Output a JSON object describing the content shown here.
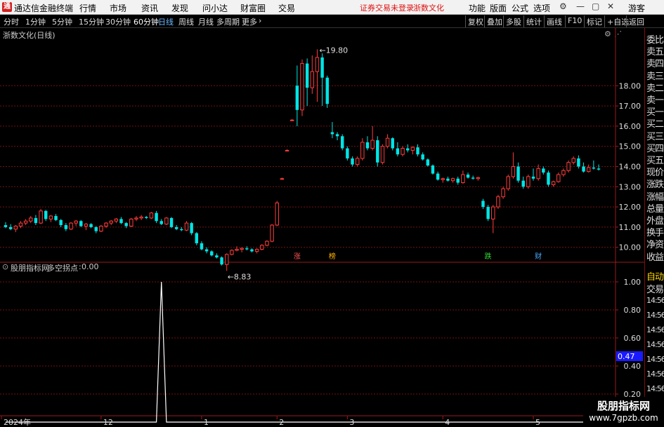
{
  "app": {
    "title": "通达信金融终端",
    "logo": "通",
    "menus": [
      "行情",
      "市场",
      "资讯",
      "发现",
      "问小达",
      "财富圈",
      "交易"
    ],
    "warning": "证券交易未登录",
    "stock_name_top": "浙数文化",
    "right_menus": [
      "功能",
      "版面",
      "公式",
      "选项"
    ],
    "user": "游客"
  },
  "period_bar": {
    "periods": [
      "分时",
      "1分钟",
      "5分钟",
      "15分钟",
      "30分钟",
      "60分钟",
      "日线",
      "周线",
      "月线",
      "多周期",
      "更多"
    ],
    "active": "日线",
    "tools": [
      "复权",
      "叠加",
      "多股",
      "统计",
      "画线",
      "F10",
      "标记",
      "+自选",
      "返回"
    ]
  },
  "main_chart": {
    "title": "浙数文化(日线)",
    "high_label": "19.80",
    "low_label": "8.83",
    "markers": [
      {
        "text": "涨",
        "color": "#ff5555"
      },
      {
        "text": "榜",
        "color": "#ffb300"
      },
      {
        "text": "跌",
        "color": "#33dd33"
      },
      {
        "text": "财",
        "color": "#4aa8ff"
      }
    ],
    "y_ticks": [
      "18.00",
      "17.00",
      "16.00",
      "15.00",
      "14.00",
      "13.00",
      "12.00",
      "11.00",
      "10.00"
    ],
    "y_range": [
      9.4,
      20.3
    ]
  },
  "indicator_chart": {
    "name": "股朋指标网",
    "line_name": "多空拐点",
    "value": "0.00",
    "y_ticks": [
      "1.00",
      "0.80",
      "0.60",
      "0.40",
      "0.20"
    ],
    "current_marker": "0.47",
    "y_range": [
      0.06,
      1.08
    ]
  },
  "x_axis": {
    "labels": [
      "2024年",
      "12",
      "1",
      "2",
      "3",
      "4",
      "5"
    ]
  },
  "side_panel": {
    "items": [
      "委比",
      "卖五",
      "卖四",
      "卖三",
      "卖二",
      "卖一",
      "买一",
      "买二",
      "买三",
      "买四",
      "买五",
      "现价",
      "涨跌",
      "涨幅",
      "总量",
      "外盘",
      "换手",
      "净资",
      "收益"
    ],
    "lower_items": [
      "自动",
      "交易"
    ],
    "times": [
      "14:56",
      "14:56",
      "14:56",
      "14:56",
      "14:56",
      "14:56",
      "14:56",
      "14:56",
      "14:56"
    ]
  },
  "watermark": {
    "line1": "股朋指标网",
    "line2": "www.7gpzb.com"
  },
  "colors": {
    "up": "#ff3c3c",
    "down": "#00e5e5",
    "grid": "#7a1010",
    "axis": "#9a1a1a",
    "indicator_line": "#ffffff",
    "marker_box": "#1a1aff"
  },
  "chart_data": {
    "type": "candlestick",
    "title": "浙数文化(日线)",
    "y_range": [
      9.4,
      20.3
    ],
    "candles": [
      {
        "o": 11.1,
        "h": 11.25,
        "l": 10.95,
        "c": 11.0
      },
      {
        "o": 11.0,
        "h": 11.15,
        "l": 10.85,
        "c": 10.9
      },
      {
        "o": 10.9,
        "h": 11.1,
        "l": 10.75,
        "c": 11.05
      },
      {
        "o": 11.05,
        "h": 11.3,
        "l": 10.95,
        "c": 11.2
      },
      {
        "o": 11.2,
        "h": 11.4,
        "l": 11.1,
        "c": 11.3
      },
      {
        "o": 11.3,
        "h": 11.55,
        "l": 11.2,
        "c": 11.45
      },
      {
        "o": 11.45,
        "h": 11.6,
        "l": 11.1,
        "c": 11.2
      },
      {
        "o": 11.2,
        "h": 11.9,
        "l": 11.15,
        "c": 11.8
      },
      {
        "o": 11.8,
        "h": 11.85,
        "l": 11.3,
        "c": 11.4
      },
      {
        "o": 11.4,
        "h": 11.6,
        "l": 11.25,
        "c": 11.55
      },
      {
        "o": 11.55,
        "h": 11.65,
        "l": 11.3,
        "c": 11.35
      },
      {
        "o": 11.35,
        "h": 11.4,
        "l": 11.0,
        "c": 11.1
      },
      {
        "o": 11.1,
        "h": 11.2,
        "l": 10.8,
        "c": 10.9
      },
      {
        "o": 10.9,
        "h": 11.25,
        "l": 10.85,
        "c": 11.2
      },
      {
        "o": 11.2,
        "h": 11.35,
        "l": 11.05,
        "c": 11.3
      },
      {
        "o": 11.3,
        "h": 11.35,
        "l": 11.0,
        "c": 11.05
      },
      {
        "o": 11.05,
        "h": 11.2,
        "l": 10.85,
        "c": 11.15
      },
      {
        "o": 11.15,
        "h": 11.2,
        "l": 10.95,
        "c": 11.0
      },
      {
        "o": 11.0,
        "h": 11.05,
        "l": 10.7,
        "c": 10.8
      },
      {
        "o": 10.8,
        "h": 11.1,
        "l": 10.75,
        "c": 11.05
      },
      {
        "o": 11.05,
        "h": 11.25,
        "l": 10.95,
        "c": 11.2
      },
      {
        "o": 11.2,
        "h": 11.35,
        "l": 11.1,
        "c": 11.3
      },
      {
        "o": 11.3,
        "h": 11.45,
        "l": 11.2,
        "c": 11.4
      },
      {
        "o": 11.4,
        "h": 11.5,
        "l": 11.15,
        "c": 11.2
      },
      {
        "o": 11.2,
        "h": 11.25,
        "l": 10.95,
        "c": 11.05
      },
      {
        "o": 11.05,
        "h": 11.45,
        "l": 11.0,
        "c": 11.4
      },
      {
        "o": 11.4,
        "h": 11.55,
        "l": 11.3,
        "c": 11.45
      },
      {
        "o": 11.45,
        "h": 11.6,
        "l": 11.35,
        "c": 11.5
      },
      {
        "o": 11.5,
        "h": 11.55,
        "l": 11.4,
        "c": 11.45
      },
      {
        "o": 11.45,
        "h": 11.75,
        "l": 11.4,
        "c": 11.7
      },
      {
        "o": 11.7,
        "h": 11.8,
        "l": 11.2,
        "c": 11.3
      },
      {
        "o": 11.3,
        "h": 11.4,
        "l": 11.1,
        "c": 11.15
      },
      {
        "o": 11.15,
        "h": 11.5,
        "l": 11.1,
        "c": 11.45
      },
      {
        "o": 11.45,
        "h": 11.5,
        "l": 10.95,
        "c": 11.0
      },
      {
        "o": 11.0,
        "h": 11.1,
        "l": 10.85,
        "c": 10.9
      },
      {
        "o": 10.9,
        "h": 11.0,
        "l": 10.8,
        "c": 10.85
      },
      {
        "o": 10.85,
        "h": 11.3,
        "l": 10.8,
        "c": 11.2
      },
      {
        "o": 11.2,
        "h": 11.25,
        "l": 10.6,
        "c": 10.7
      },
      {
        "o": 10.7,
        "h": 10.75,
        "l": 10.1,
        "c": 10.2
      },
      {
        "o": 10.2,
        "h": 10.3,
        "l": 9.85,
        "c": 9.9
      },
      {
        "o": 9.9,
        "h": 10.0,
        "l": 9.7,
        "c": 9.8
      },
      {
        "o": 9.8,
        "h": 9.85,
        "l": 9.55,
        "c": 9.6
      },
      {
        "o": 9.6,
        "h": 9.7,
        "l": 9.45,
        "c": 9.5
      },
      {
        "o": 9.5,
        "h": 9.55,
        "l": 9.1,
        "c": 9.15
      },
      {
        "o": 9.15,
        "h": 9.7,
        "l": 8.83,
        "c": 9.65
      },
      {
        "o": 9.65,
        "h": 9.9,
        "l": 9.6,
        "c": 9.85
      },
      {
        "o": 9.85,
        "h": 10.05,
        "l": 9.8,
        "c": 9.9
      },
      {
        "o": 9.9,
        "h": 10.0,
        "l": 9.75,
        "c": 9.95
      },
      {
        "o": 9.95,
        "h": 10.05,
        "l": 9.85,
        "c": 9.9
      },
      {
        "o": 9.9,
        "h": 9.95,
        "l": 9.75,
        "c": 9.8
      },
      {
        "o": 9.8,
        "h": 9.95,
        "l": 9.7,
        "c": 9.9
      },
      {
        "o": 9.9,
        "h": 10.15,
        "l": 9.85,
        "c": 10.1
      },
      {
        "o": 10.1,
        "h": 10.35,
        "l": 10.05,
        "c": 10.3
      },
      {
        "o": 10.3,
        "h": 11.15,
        "l": 10.25,
        "c": 11.1
      },
      {
        "o": 11.1,
        "h": 12.3,
        "l": 11.05,
        "c": 12.2
      },
      {
        "o": 13.4,
        "h": 13.45,
        "l": 13.4,
        "c": 13.4
      },
      {
        "o": 14.8,
        "h": 14.85,
        "l": 14.8,
        "c": 14.8
      },
      {
        "o": 16.3,
        "h": 16.35,
        "l": 16.3,
        "c": 16.3
      },
      {
        "o": 18.0,
        "h": 19.0,
        "l": 16.0,
        "c": 16.8
      },
      {
        "o": 16.8,
        "h": 19.3,
        "l": 16.5,
        "c": 19.1
      },
      {
        "o": 19.1,
        "h": 19.35,
        "l": 17.0,
        "c": 17.9
      },
      {
        "o": 17.9,
        "h": 19.5,
        "l": 17.6,
        "c": 18.7
      },
      {
        "o": 18.7,
        "h": 19.8,
        "l": 17.2,
        "c": 19.4
      },
      {
        "o": 19.4,
        "h": 19.6,
        "l": 17.0,
        "c": 18.4
      },
      {
        "o": 18.4,
        "h": 18.5,
        "l": 16.9,
        "c": 17.1
      },
      {
        "o": 15.7,
        "h": 16.2,
        "l": 15.4,
        "c": 15.6
      },
      {
        "o": 15.6,
        "h": 15.7,
        "l": 15.3,
        "c": 15.5
      },
      {
        "o": 15.5,
        "h": 15.6,
        "l": 14.8,
        "c": 14.9
      },
      {
        "o": 14.9,
        "h": 15.0,
        "l": 14.3,
        "c": 14.4
      },
      {
        "o": 14.4,
        "h": 14.5,
        "l": 14.0,
        "c": 14.1
      },
      {
        "o": 14.1,
        "h": 14.5,
        "l": 14.0,
        "c": 14.4
      },
      {
        "o": 14.4,
        "h": 15.4,
        "l": 14.3,
        "c": 15.2
      },
      {
        "o": 15.2,
        "h": 15.5,
        "l": 14.8,
        "c": 14.9
      },
      {
        "o": 14.9,
        "h": 16.0,
        "l": 14.8,
        "c": 15.3
      },
      {
        "o": 15.3,
        "h": 15.5,
        "l": 14.0,
        "c": 14.2
      },
      {
        "o": 14.2,
        "h": 15.1,
        "l": 14.1,
        "c": 15.0
      },
      {
        "o": 15.0,
        "h": 15.6,
        "l": 14.9,
        "c": 15.4
      },
      {
        "o": 15.4,
        "h": 15.45,
        "l": 14.8,
        "c": 14.9
      },
      {
        "o": 14.9,
        "h": 15.2,
        "l": 14.5,
        "c": 14.6
      },
      {
        "o": 14.6,
        "h": 15.0,
        "l": 14.5,
        "c": 14.9
      },
      {
        "o": 14.9,
        "h": 15.1,
        "l": 14.7,
        "c": 14.8
      },
      {
        "o": 14.8,
        "h": 15.0,
        "l": 14.6,
        "c": 14.95
      },
      {
        "o": 14.95,
        "h": 15.1,
        "l": 14.5,
        "c": 14.6
      },
      {
        "o": 14.6,
        "h": 14.7,
        "l": 14.3,
        "c": 14.35
      },
      {
        "o": 14.35,
        "h": 14.4,
        "l": 14.0,
        "c": 14.05
      },
      {
        "o": 14.05,
        "h": 14.1,
        "l": 13.6,
        "c": 13.65
      },
      {
        "o": 13.65,
        "h": 13.75,
        "l": 13.3,
        "c": 13.35
      },
      {
        "o": 13.35,
        "h": 13.45,
        "l": 13.2,
        "c": 13.4
      },
      {
        "o": 13.4,
        "h": 13.5,
        "l": 13.25,
        "c": 13.3
      },
      {
        "o": 13.3,
        "h": 13.45,
        "l": 13.2,
        "c": 13.4
      },
      {
        "o": 13.4,
        "h": 13.5,
        "l": 13.1,
        "c": 13.2
      },
      {
        "o": 13.2,
        "h": 13.8,
        "l": 13.15,
        "c": 13.6
      },
      {
        "o": 13.6,
        "h": 13.7,
        "l": 13.4,
        "c": 13.45
      },
      {
        "o": 13.45,
        "h": 13.55,
        "l": 13.35,
        "c": 13.4
      },
      {
        "o": 13.4,
        "h": 13.5,
        "l": 13.3,
        "c": 13.45
      },
      {
        "o": 12.3,
        "h": 12.4,
        "l": 11.9,
        "c": 12.0
      },
      {
        "o": 12.0,
        "h": 12.1,
        "l": 11.3,
        "c": 11.4
      },
      {
        "o": 11.4,
        "h": 12.1,
        "l": 10.7,
        "c": 12.0
      },
      {
        "o": 12.0,
        "h": 12.6,
        "l": 11.9,
        "c": 12.5
      },
      {
        "o": 12.5,
        "h": 13.0,
        "l": 12.4,
        "c": 12.9
      },
      {
        "o": 12.9,
        "h": 13.6,
        "l": 12.8,
        "c": 13.5
      },
      {
        "o": 13.5,
        "h": 14.7,
        "l": 13.4,
        "c": 14.0
      },
      {
        "o": 14.0,
        "h": 14.2,
        "l": 13.2,
        "c": 13.3
      },
      {
        "o": 13.3,
        "h": 13.5,
        "l": 12.9,
        "c": 13.0
      },
      {
        "o": 13.0,
        "h": 13.6,
        "l": 12.9,
        "c": 13.5
      },
      {
        "o": 13.5,
        "h": 13.9,
        "l": 13.3,
        "c": 13.4
      },
      {
        "o": 13.4,
        "h": 14.1,
        "l": 13.3,
        "c": 13.9
      },
      {
        "o": 13.9,
        "h": 14.0,
        "l": 13.6,
        "c": 13.7
      },
      {
        "o": 13.7,
        "h": 13.8,
        "l": 13.0,
        "c": 13.1
      },
      {
        "o": 13.1,
        "h": 13.3,
        "l": 13.0,
        "c": 13.25
      },
      {
        "o": 13.25,
        "h": 13.7,
        "l": 13.2,
        "c": 13.6
      },
      {
        "o": 13.6,
        "h": 13.9,
        "l": 13.5,
        "c": 13.8
      },
      {
        "o": 13.8,
        "h": 14.3,
        "l": 13.7,
        "c": 14.2
      },
      {
        "o": 14.2,
        "h": 14.5,
        "l": 14.1,
        "c": 14.4
      },
      {
        "o": 14.4,
        "h": 14.55,
        "l": 13.9,
        "c": 14.0
      },
      {
        "o": 14.0,
        "h": 14.2,
        "l": 13.7,
        "c": 13.75
      },
      {
        "o": 13.75,
        "h": 14.1,
        "l": 13.7,
        "c": 13.95
      },
      {
        "o": 13.95,
        "h": 14.3,
        "l": 13.85,
        "c": 13.9
      },
      {
        "o": 13.9,
        "h": 14.1,
        "l": 13.8,
        "c": 13.85
      }
    ],
    "indicator": {
      "name": "多空拐点",
      "peak_index": 31,
      "peak_value": 1.0,
      "base_value": 0.0
    }
  }
}
